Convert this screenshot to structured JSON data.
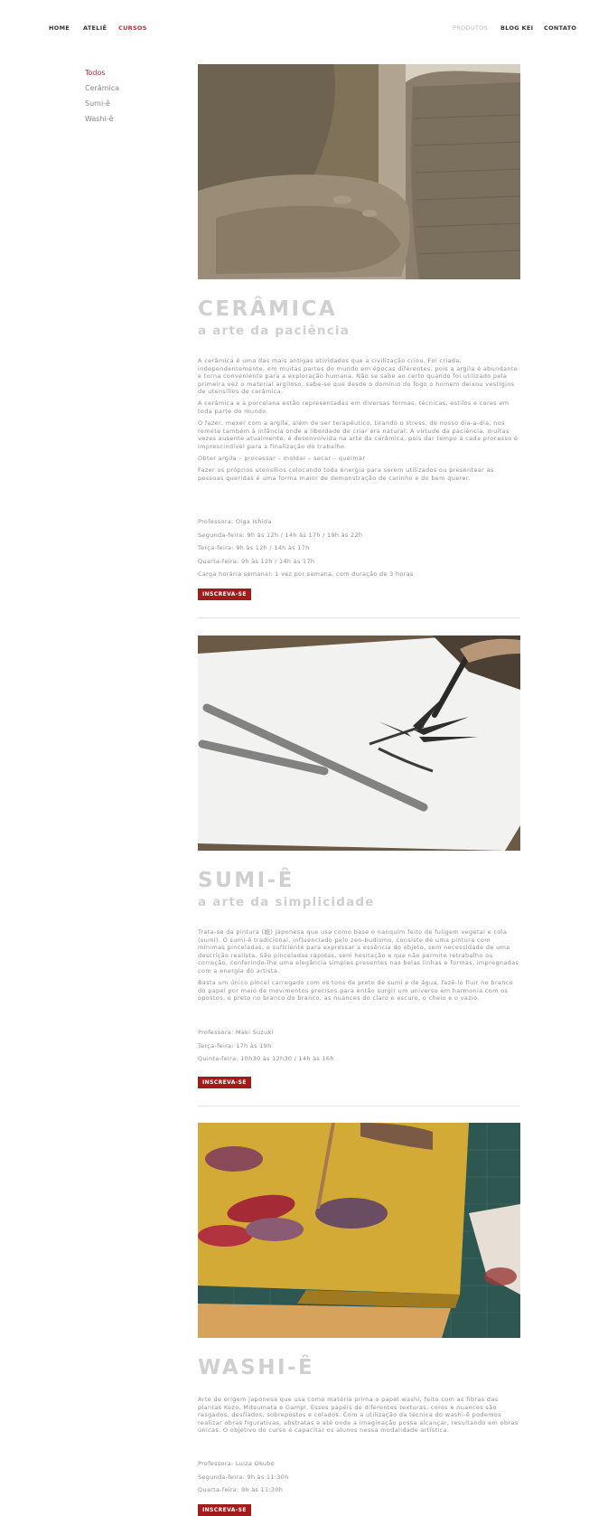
{
  "nav": {
    "left": [
      {
        "label": "HOME"
      },
      {
        "label": "ATELIÊ"
      },
      {
        "label": "CURSOS",
        "active": true
      }
    ],
    "right": [
      {
        "label": "PRODUTOS"
      },
      {
        "label": "BLOG KEI"
      },
      {
        "label": "CONTATO"
      }
    ]
  },
  "filters": [
    {
      "label": "Todos",
      "active": true
    },
    {
      "label": "Cerâmica"
    },
    {
      "label": "Sumi-ê"
    },
    {
      "label": "Washi-ê"
    }
  ],
  "colors": {
    "accent": "#a31a1a",
    "title": "#d0d0d0",
    "text": "#8f8f8f"
  },
  "courses": [
    {
      "title": "CERÂMICA",
      "subtitle": "a arte da paciência",
      "image_icon": "pottery-wheel-photo",
      "paragraphs": [
        "A cerâmica é uma das mais antigas atividades que a civilização criou. Foi criada, independentemente, em muitas partes do mundo em épocas diferentes, pois a argila é abundante e torna conveniente para a exploração humana. Não se sabe ao certo quando foi utilizado pela primeira vez o material argiloso, sabe-se que desde o domínio do fogo o homem deixou vestígios de utensílios de cerâmica.",
        "A cerâmica e a porcelana estão representadas em diversas formas, técnicas, estilos e cores em toda parte do mundo.",
        "O fazer, mexer com a argila, além de ser terapêutico, tirando o stress, de nosso dia-a-dia, nos remete também à infância onde a liberdade de criar era natural. A virtude da paciência, muitas vezes ausente atualmente, é desenvolvida na arte da cerâmica, pois dar tempo a cada processo é imprescindível para a finalização do trabalho.",
        "Obter argila – processar – moldar – secar – queimar",
        "Fazer os próprios utensílios colocando toda energia para serem utilizados ou presentear as pessoas queridas é uma forma maior de demonstração de carinho e do bem querer."
      ],
      "schedule": [
        "Professora: Olga Ishida",
        "Segunda-feira: 9h às 12h / 14h às 17h / 19h às 22h",
        "Terça-feira: 9h às 12h / 14h às 17h",
        "Quarta-feira: 9h às 12h / 14h às 17h",
        "Carga horária semanal: 1 vez por semana, com duração de 3 horas"
      ],
      "button": "INSCREVA-SE"
    },
    {
      "title": "SUMI-Ê",
      "subtitle": "a arte da simplicidade",
      "image_icon": "ink-painting-photo",
      "paragraphs": [
        "Trata-se da pintura (絵) japonesa que usa como base o nanquim feito de fuligem vegetal e cola (sumi). O sumi-ê tradicional, influenciado pelo zen-budismo, consiste de uma pintura com mínimas pinceladas, o suficiente para expressar a essência do objeto, sem necessidade de uma descrição realista. São pinceladas rápidas, sem hesitação e que não permite retrabalho ou correção, conferindo-lhe uma elegância simples presentes nas belas linhas e formas, impregnadas com a energia do artista.",
        "Basta um único pincel carregado com os tons de preto de sumi e de água, fazê-lo fluir no branco do papel por meio de movimentos precisos para então surgir um universo em harmonia com os opostos: o preto no branco do branco, as nuances do claro e escuro, o cheio e o vazio."
      ],
      "schedule": [
        "Professora: Maki Suzuki",
        "Terça-feira: 17h às 19h",
        "Quinta-feira: 10h30 às 12h30 / 14h às 16h"
      ],
      "button": "INSCREVA-SE"
    },
    {
      "title": "WASHI-Ê",
      "subtitle": "",
      "image_icon": "paper-collage-photo",
      "paragraphs": [
        "Arte de origem japonesa que usa como matéria prima o papel washi, feito com as fibras das plantas Kozo, Mitsumata e Gampi. Esses papéis de diferentes texturas, cores e nuances são rasgados, desfiados, sobrepostos e colados. Com a utilização da técnica do washi-ê podemos realizar obras figurativas, abstratas e até onde a imaginação possa alcançar, resultando em obras únicas. O objetivo do curso é capacitar os alunos nessa modalidade artística."
      ],
      "schedule": [
        "Professora: Luiza Okubo",
        "Segunda-feira: 9h às 11:30h",
        "Quarta-feira: 9h às 11:30h"
      ],
      "button": "INSCREVA-SE"
    }
  ]
}
